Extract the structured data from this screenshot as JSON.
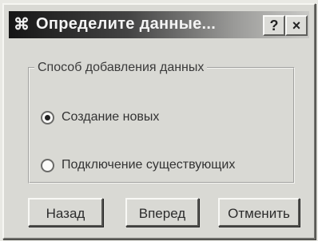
{
  "window": {
    "title": "Определите данные...",
    "icon": "app-icon",
    "help_label": "?",
    "close_label": "×"
  },
  "group": {
    "legend": "Способ добавления данных",
    "options": [
      {
        "label": "Создание новых",
        "selected": true
      },
      {
        "label": "Подключение существующих",
        "selected": false
      }
    ]
  },
  "buttons": {
    "back": "Назад",
    "next": "Вперед",
    "cancel": "Отменить"
  }
}
